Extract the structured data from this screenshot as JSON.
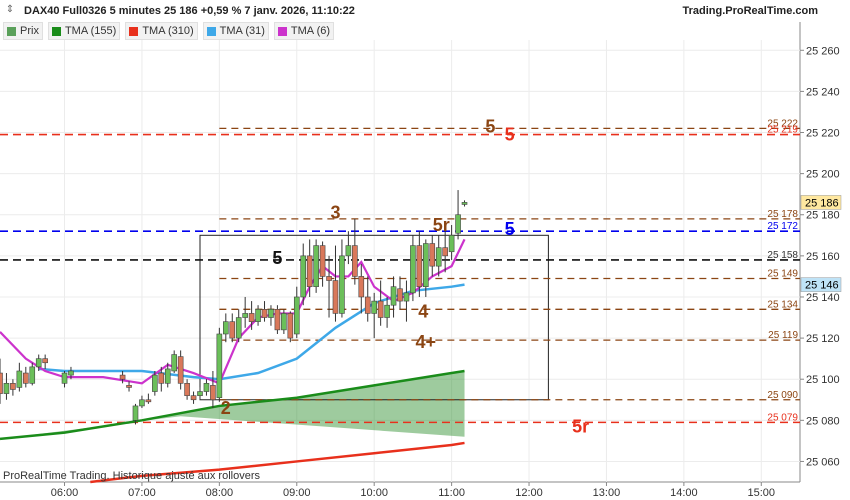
{
  "header": {
    "title": "DAX40 Full0326 5 minutes 25 186 +0,59 % 7 janv. 2026, 11:10:22",
    "site": "Trading.ProRealTime.com"
  },
  "legend": [
    {
      "label": "Prix",
      "color": "#5aa05a"
    },
    {
      "label": "TMA (155)",
      "color": "#1a8c1a"
    },
    {
      "label": "TMA (310)",
      "color": "#e8301c"
    },
    {
      "label": "TMA (31)",
      "color": "#3ea8e8"
    },
    {
      "label": "TMA (6)",
      "color": "#cc33cc"
    }
  ],
  "footer_note": "ProRealTime Trading. Historique ajusté aux rollovers",
  "chart_data": {
    "type": "candlestick",
    "x_ticks": [
      "06:00",
      "07:00",
      "08:00",
      "09:00",
      "10:00",
      "11:00",
      "12:00",
      "13:00",
      "14:00",
      "15:00"
    ],
    "y_ticks": [
      25060,
      25080,
      25100,
      25120,
      25140,
      25160,
      25180,
      25200,
      25220,
      25240,
      25260
    ],
    "ylim": [
      25050,
      25265
    ],
    "xlim": [
      "05:10",
      "15:30"
    ],
    "last_price": 25186,
    "candles_approx": [
      {
        "t": "05:10",
        "o": 25103,
        "h": 25110,
        "c": 25093,
        "l": 25088
      },
      {
        "t": "05:15",
        "o": 25093,
        "h": 25103,
        "c": 25098,
        "l": 25090
      },
      {
        "t": "05:20",
        "o": 25098,
        "h": 25100,
        "c": 25095,
        "l": 25092
      },
      {
        "t": "05:25",
        "o": 25096,
        "h": 25108,
        "c": 25104,
        "l": 25094
      },
      {
        "t": "05:30",
        "o": 25103,
        "h": 25106,
        "c": 25098,
        "l": 25096
      },
      {
        "t": "05:35",
        "o": 25098,
        "h": 25108,
        "c": 25106,
        "l": 25097
      },
      {
        "t": "05:40",
        "o": 25106,
        "h": 25112,
        "c": 25110,
        "l": 25104
      },
      {
        "t": "05:45",
        "o": 25110,
        "h": 25112,
        "c": 25108,
        "l": 25105
      },
      {
        "t": "06:00",
        "o": 25098,
        "h": 25104,
        "c": 25103,
        "l": 25096
      },
      {
        "t": "06:05",
        "o": 25102,
        "h": 25106,
        "c": 25104,
        "l": 25100
      },
      {
        "t": "06:45",
        "o": 25102,
        "h": 25104,
        "c": 25100,
        "l": 25098
      },
      {
        "t": "06:50",
        "o": 25097,
        "h": 25099,
        "c": 25096,
        "l": 25094
      },
      {
        "t": "06:55",
        "o": 25080,
        "h": 25088,
        "c": 25087,
        "l": 25078
      },
      {
        "t": "07:00",
        "o": 25087,
        "h": 25092,
        "c": 25090,
        "l": 25086
      },
      {
        "t": "07:05",
        "o": 25090,
        "h": 25093,
        "c": 25089,
        "l": 25088
      },
      {
        "t": "07:10",
        "o": 25094,
        "h": 25104,
        "c": 25102,
        "l": 25092
      },
      {
        "t": "07:15",
        "o": 25103,
        "h": 25106,
        "c": 25098,
        "l": 25094
      },
      {
        "t": "07:20",
        "o": 25098,
        "h": 25108,
        "c": 25105,
        "l": 25096
      },
      {
        "t": "07:25",
        "o": 25104,
        "h": 25114,
        "c": 25112,
        "l": 25103
      },
      {
        "t": "07:30",
        "o": 25111,
        "h": 25114,
        "c": 25098,
        "l": 25095
      },
      {
        "t": "07:35",
        "o": 25098,
        "h": 25100,
        "c": 25092,
        "l": 25090
      },
      {
        "t": "07:40",
        "o": 25092,
        "h": 25094,
        "c": 25090,
        "l": 25088
      },
      {
        "t": "07:45",
        "o": 25092,
        "h": 25096,
        "c": 25094,
        "l": 25090
      },
      {
        "t": "07:50",
        "o": 25094,
        "h": 25100,
        "c": 25098,
        "l": 25092
      },
      {
        "t": "07:55",
        "o": 25097,
        "h": 25104,
        "c": 25090,
        "l": 25086
      },
      {
        "t": "08:00",
        "o": 25091,
        "h": 25125,
        "c": 25122,
        "l": 25089
      },
      {
        "t": "08:05",
        "o": 25122,
        "h": 25132,
        "c": 25128,
        "l": 25118
      },
      {
        "t": "08:10",
        "o": 25128,
        "h": 25132,
        "c": 25120,
        "l": 25118
      },
      {
        "t": "08:15",
        "o": 25120,
        "h": 25134,
        "c": 25130,
        "l": 25118
      },
      {
        "t": "08:20",
        "o": 25130,
        "h": 25140,
        "c": 25132,
        "l": 25125
      },
      {
        "t": "08:25",
        "o": 25132,
        "h": 25138,
        "c": 25128,
        "l": 25124
      },
      {
        "t": "08:30",
        "o": 25128,
        "h": 25136,
        "c": 25134,
        "l": 25126
      },
      {
        "t": "08:35",
        "o": 25134,
        "h": 25138,
        "c": 25130,
        "l": 25128
      },
      {
        "t": "08:40",
        "o": 25130,
        "h": 25136,
        "c": 25134,
        "l": 25126
      },
      {
        "t": "08:45",
        "o": 25134,
        "h": 25136,
        "c": 25124,
        "l": 25122
      },
      {
        "t": "08:50",
        "o": 25124,
        "h": 25134,
        "c": 25132,
        "l": 25122
      },
      {
        "t": "08:55",
        "o": 25132,
        "h": 25133,
        "c": 25120,
        "l": 25118
      },
      {
        "t": "09:00",
        "o": 25122,
        "h": 25145,
        "c": 25140,
        "l": 25120
      },
      {
        "t": "09:05",
        "o": 25140,
        "h": 25166,
        "c": 25160,
        "l": 25136
      },
      {
        "t": "09:10",
        "o": 25160,
        "h": 25168,
        "c": 25145,
        "l": 25140
      },
      {
        "t": "09:15",
        "o": 25145,
        "h": 25168,
        "c": 25165,
        "l": 25142
      },
      {
        "t": "09:20",
        "o": 25165,
        "h": 25167,
        "c": 25150,
        "l": 25145
      },
      {
        "t": "09:25",
        "o": 25150,
        "h": 25160,
        "c": 25148,
        "l": 25130
      },
      {
        "t": "09:30",
        "o": 25148,
        "h": 25165,
        "c": 25132,
        "l": 25128
      },
      {
        "t": "09:35",
        "o": 25132,
        "h": 25168,
        "c": 25160,
        "l": 25130
      },
      {
        "t": "09:40",
        "o": 25160,
        "h": 25172,
        "c": 25165,
        "l": 25156
      },
      {
        "t": "09:45",
        "o": 25165,
        "h": 25178,
        "c": 25150,
        "l": 25146
      },
      {
        "t": "09:50",
        "o": 25150,
        "h": 25156,
        "c": 25140,
        "l": 25132
      },
      {
        "t": "09:55",
        "o": 25140,
        "h": 25150,
        "c": 25132,
        "l": 25128
      },
      {
        "t": "10:00",
        "o": 25132,
        "h": 25142,
        "c": 25138,
        "l": 25120
      },
      {
        "t": "10:05",
        "o": 25138,
        "h": 25148,
        "c": 25130,
        "l": 25126
      },
      {
        "t": "10:10",
        "o": 25130,
        "h": 25140,
        "c": 25136,
        "l": 25125
      },
      {
        "t": "10:15",
        "o": 25136,
        "h": 25150,
        "c": 25145,
        "l": 25130
      },
      {
        "t": "10:20",
        "o": 25144,
        "h": 25150,
        "c": 25138,
        "l": 25134
      },
      {
        "t": "10:25",
        "o": 25138,
        "h": 25148,
        "c": 25142,
        "l": 25128
      },
      {
        "t": "10:30",
        "o": 25142,
        "h": 25170,
        "c": 25165,
        "l": 25138
      },
      {
        "t": "10:35",
        "o": 25165,
        "h": 25172,
        "c": 25145,
        "l": 25140
      },
      {
        "t": "10:40",
        "o": 25145,
        "h": 25168,
        "c": 25166,
        "l": 25140
      },
      {
        "t": "10:45",
        "o": 25166,
        "h": 25170,
        "c": 25155,
        "l": 25150
      },
      {
        "t": "10:50",
        "o": 25155,
        "h": 25170,
        "c": 25164,
        "l": 25150
      },
      {
        "t": "10:55",
        "o": 25164,
        "h": 25175,
        "c": 25160,
        "l": 25152
      },
      {
        "t": "11:00",
        "o": 25162,
        "h": 25175,
        "c": 25170,
        "l": 25158
      },
      {
        "t": "11:05",
        "o": 25171,
        "h": 25192,
        "c": 25180,
        "l": 25168
      },
      {
        "t": "11:10",
        "o": 25185,
        "h": 25187,
        "c": 25186,
        "l": 25184
      }
    ],
    "indicators": [
      {
        "name": "TMA (155)",
        "color": "#1a8c1a",
        "points": [
          [
            "05:10",
            25071
          ],
          [
            "06:00",
            25074
          ],
          [
            "07:00",
            25080
          ],
          [
            "08:00",
            25087
          ],
          [
            "09:00",
            25091
          ],
          [
            "10:00",
            25097
          ],
          [
            "11:00",
            25103
          ],
          [
            "11:10",
            25104
          ]
        ]
      },
      {
        "name": "TMA (310)",
        "color": "#e8301c",
        "points": [
          [
            "06:20",
            25050
          ],
          [
            "07:00",
            25053
          ],
          [
            "08:00",
            25056
          ],
          [
            "09:00",
            25060
          ],
          [
            "10:00",
            25064
          ],
          [
            "11:00",
            25068
          ],
          [
            "11:10",
            25069
          ]
        ]
      },
      {
        "name": "TMA (31)",
        "color": "#3ea8e8",
        "points": [
          [
            "05:40",
            25105
          ],
          [
            "06:00",
            25104
          ],
          [
            "07:00",
            25104
          ],
          [
            "07:40",
            25101
          ],
          [
            "08:00",
            25100
          ],
          [
            "08:30",
            25103
          ],
          [
            "09:00",
            25110
          ],
          [
            "09:30",
            25125
          ],
          [
            "10:00",
            25137
          ],
          [
            "10:30",
            25143
          ],
          [
            "11:00",
            25145
          ],
          [
            "11:10",
            25146
          ]
        ]
      },
      {
        "name": "TMA (6)",
        "color": "#cc33cc",
        "points": [
          [
            "05:10",
            25123
          ],
          [
            "05:30",
            25110
          ],
          [
            "05:45",
            25104
          ],
          [
            "06:00",
            25101
          ],
          [
            "06:30",
            25101
          ],
          [
            "07:00",
            25098
          ],
          [
            "07:20",
            25107
          ],
          [
            "07:40",
            25103
          ],
          [
            "08:00",
            25098
          ],
          [
            "08:15",
            25120
          ],
          [
            "08:30",
            25130
          ],
          [
            "08:45",
            25132
          ],
          [
            "09:00",
            25132
          ],
          [
            "09:10",
            25145
          ],
          [
            "09:20",
            25155
          ],
          [
            "09:30",
            25150
          ],
          [
            "09:40",
            25150
          ],
          [
            "09:50",
            25157
          ],
          [
            "10:00",
            25145
          ],
          [
            "10:15",
            25138
          ],
          [
            "10:30",
            25142
          ],
          [
            "10:45",
            25150
          ],
          [
            "11:00",
            25155
          ],
          [
            "11:10",
            25168
          ]
        ]
      }
    ],
    "horizontal_lines": [
      {
        "label": "25 222",
        "value": 25222,
        "color": "#8b4513",
        "style": "dash"
      },
      {
        "label": "25 219",
        "value": 25219,
        "color": "#e8301c",
        "style": "dash"
      },
      {
        "label": "25 178",
        "value": 25178,
        "color": "#8b4513",
        "style": "dash"
      },
      {
        "label": "25 172",
        "value": 25172,
        "color": "#0000ee",
        "style": "dash"
      },
      {
        "label": "25 158",
        "value": 25158,
        "color": "#111111",
        "style": "dash"
      },
      {
        "label": "25 149",
        "value": 25149,
        "color": "#8b4513",
        "style": "dash"
      },
      {
        "label": "25 134",
        "value": 25134,
        "color": "#8b4513",
        "style": "dash"
      },
      {
        "label": "25 119",
        "value": 25119,
        "color": "#8b4513",
        "style": "dash"
      },
      {
        "label": "25 090",
        "value": 25090,
        "color": "#8b4513",
        "style": "dash"
      },
      {
        "label": "25 079",
        "value": 25079,
        "color": "#e8301c",
        "style": "dash"
      }
    ],
    "price_tags": [
      {
        "label": "25 186",
        "value": 25186,
        "bg": "#ffe8a0",
        "color": "#000"
      },
      {
        "label": "25 146",
        "value": 25146,
        "bg": "#bfe3f7",
        "color": "#000"
      }
    ],
    "annotations": [
      {
        "text": "5",
        "color": "#8b4513",
        "t": "11:30",
        "v": 25223
      },
      {
        "text": "5",
        "color": "#e8301c",
        "t": "11:45",
        "v": 25219
      },
      {
        "text": "3",
        "color": "#8b4513",
        "t": "09:30",
        "v": 25181
      },
      {
        "text": "5r",
        "color": "#8b4513",
        "t": "10:52",
        "v": 25175
      },
      {
        "text": "5",
        "color": "#0000ee",
        "t": "11:45",
        "v": 25173
      },
      {
        "text": "5",
        "color": "#111111",
        "t": "08:45",
        "v": 25159
      },
      {
        "text": "4",
        "color": "#8b4513",
        "t": "10:38",
        "v": 25133
      },
      {
        "text": "4+",
        "color": "#8b4513",
        "t": "10:40",
        "v": 25118
      },
      {
        "text": "2",
        "color": "#8b4513",
        "t": "08:05",
        "v": 25086
      },
      {
        "text": "5r",
        "color": "#e8301c",
        "t": "12:40",
        "v": 25077
      }
    ],
    "box": {
      "t1": "07:45",
      "t2": "12:15",
      "v1": 25090,
      "v2": 25170
    }
  }
}
